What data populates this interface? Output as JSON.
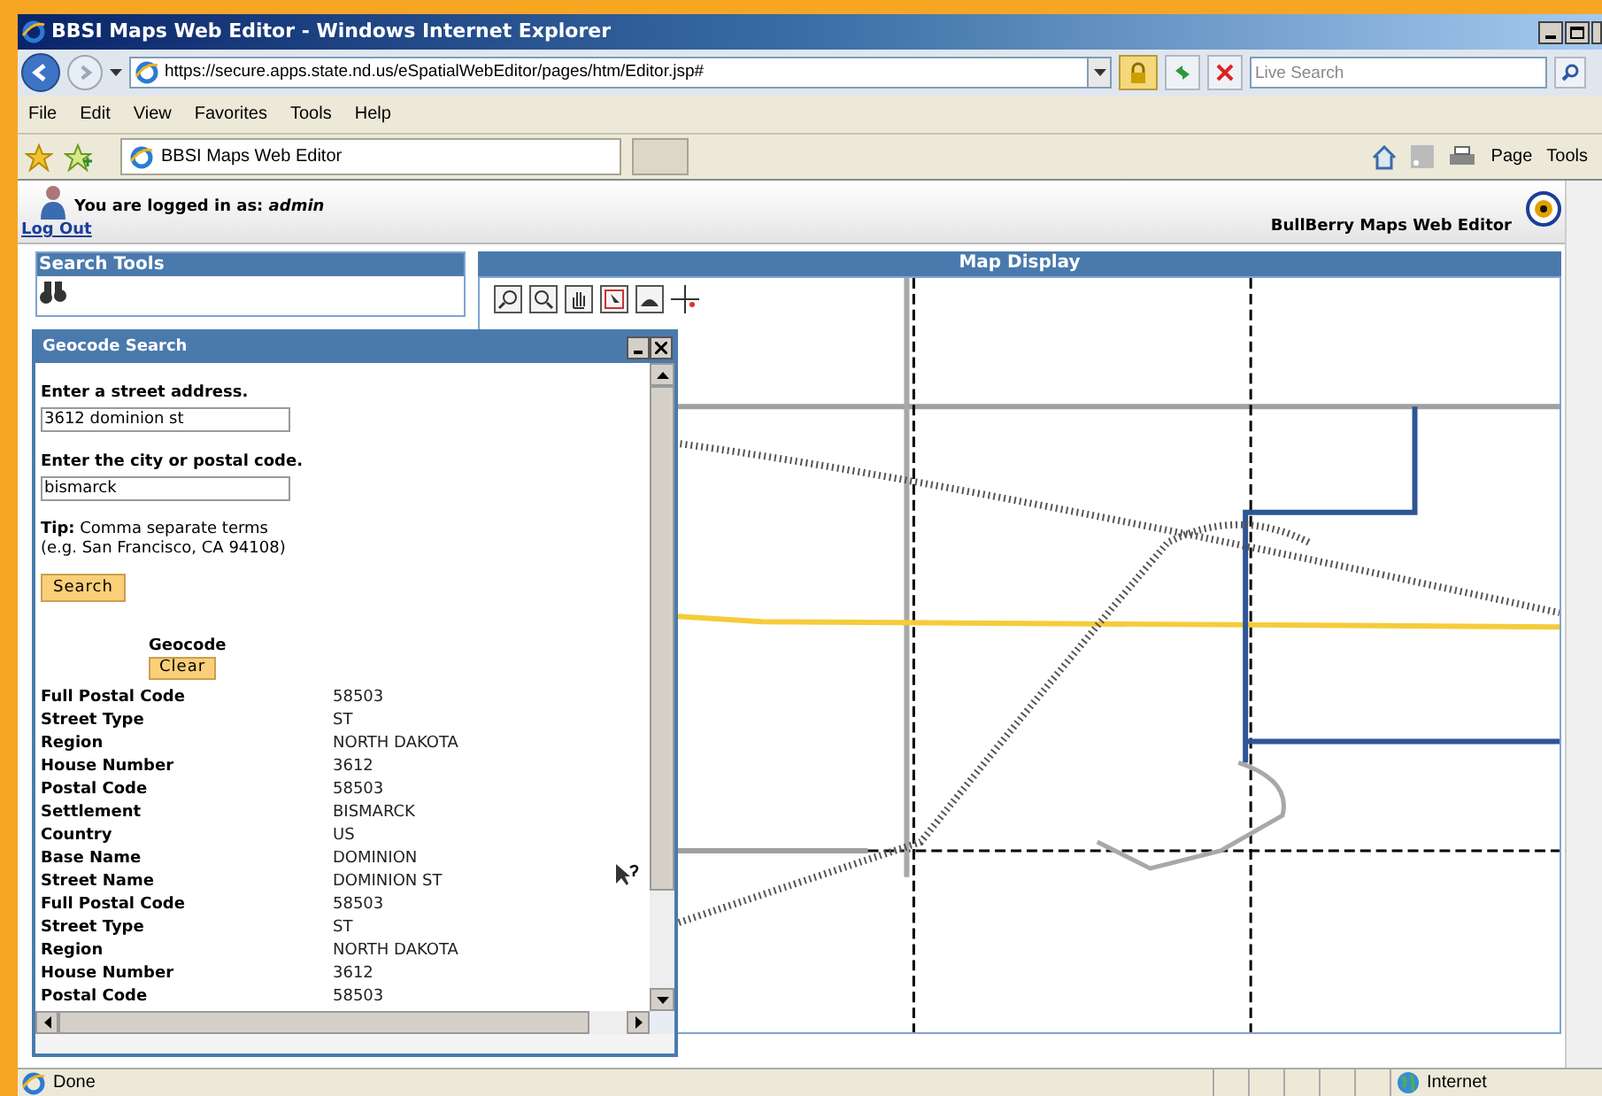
{
  "window": {
    "title": "BBSI Maps Web Editor - Windows Internet Explorer"
  },
  "nav": {
    "address": "https://secure.apps.state.nd.us/eSpatialWebEditor/pages/htm/Editor.jsp#",
    "search": {
      "placeholder": "Live Search"
    }
  },
  "menu": [
    "File",
    "Edit",
    "View",
    "Favorites",
    "Tools",
    "Help"
  ],
  "tabs": [
    {
      "label": "BBSI Maps Web Editor",
      "selected": true
    }
  ],
  "command_bar": [
    "Page",
    "Tools"
  ],
  "header": {
    "login_text": "You are logged in as: *admin*",
    "logout": "Log Out",
    "app_name": "BullBerry Maps Web Editor"
  },
  "search_tools": {
    "title": "Search Tools"
  },
  "map_display": {
    "title": "Map Display"
  },
  "geocode_panel": {
    "title": "Geocode Search",
    "fields": [
      {
        "label": "Enter a street address.",
        "value": "3612 dominion st"
      },
      {
        "label": "Enter the city or postal code.",
        "value": "bismarck"
      }
    ],
    "tip": "**Tip:** Comma separate terms",
    "tip_example": "(e.g. San Francisco, CA 94108)",
    "search_button": "Search",
    "geocode_label": "Geocode",
    "clear_button": "Clear",
    "results": [
      {
        "label": "Full Postal Code",
        "value": "58503"
      },
      {
        "label": "Street Type",
        "value": "ST"
      },
      {
        "label": "Region",
        "value": "NORTH DAKOTA"
      },
      {
        "label": "House Number",
        "value": "3612"
      },
      {
        "label": "Postal Code",
        "value": "58503"
      },
      {
        "label": "Settlement",
        "value": "BISMARCK"
      },
      {
        "label": "Country",
        "value": "US"
      },
      {
        "label": "Base Name",
        "value": "DOMINION"
      },
      {
        "label": "Street Name",
        "value": "DOMINION ST"
      },
      {
        "label": "Full Postal Code",
        "value": "58503"
      },
      {
        "label": "Street Type",
        "value": "ST"
      },
      {
        "label": "Region",
        "value": "NORTH DAKOTA"
      },
      {
        "label": "House Number",
        "value": "3612"
      },
      {
        "label": "Postal Code",
        "value": "58503"
      }
    ]
  },
  "status_bar": {
    "text": "Done",
    "zone": "Internet"
  }
}
